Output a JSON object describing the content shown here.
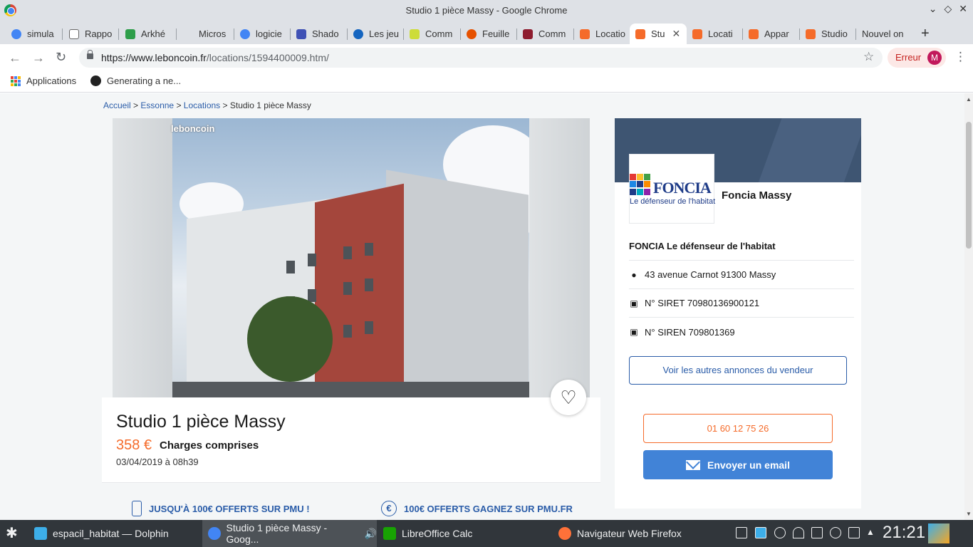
{
  "window": {
    "title": "Studio 1 pièce Massy - Google Chrome"
  },
  "tabs": [
    {
      "label": "simula",
      "color": "#4285f4"
    },
    {
      "label": "Rappo",
      "color": "#cccccc"
    },
    {
      "label": "Arkhé",
      "color": "#2e9e4a"
    },
    {
      "label": "Micros",
      "color": "#dee1e6"
    },
    {
      "label": "logicie",
      "color": "#4285f4"
    },
    {
      "label": "Shado",
      "color": "#3f51b5"
    },
    {
      "label": "Les jeu",
      "color": "#1565c0"
    },
    {
      "label": "Comm",
      "color": "#cddc39"
    },
    {
      "label": "Feuille",
      "color": "#e65100"
    },
    {
      "label": "Comm",
      "color": "#8e1c2f"
    },
    {
      "label": "Locatio",
      "color": "#f56b2a"
    },
    {
      "label": "Stu",
      "color": "#f56b2a",
      "active": true
    },
    {
      "label": "Locati",
      "color": "#f56b2a"
    },
    {
      "label": "Appar",
      "color": "#f56b2a"
    },
    {
      "label": "Studio",
      "color": "#f56b2a"
    },
    {
      "label": "Nouvel on",
      "color": "#dee1e6"
    }
  ],
  "address_bar": {
    "host": "https://www.leboncoin.fr",
    "path": "/locations/1594400009.htm/",
    "error_label": "Erreur",
    "profile_initial": "M"
  },
  "bookmarks": {
    "apps_label": "Applications",
    "item_label": "Generating a ne..."
  },
  "breadcrumb": {
    "home": "Accueil",
    "region": "Essonne",
    "category": "Locations",
    "current": "Studio 1 pièce Massy",
    "sep": ">"
  },
  "listing": {
    "watermark": "leboncoin",
    "title": "Studio 1 pièce Massy",
    "price": "358 €",
    "charges": "Charges comprises",
    "date": "03/04/2019 à 08h39"
  },
  "promos": [
    {
      "label": "JUSQU'À 100€ OFFERTS SUR PMU !"
    },
    {
      "label": "100€ OFFERTS GAGNEZ SUR PMU.FR",
      "glyph": "€"
    }
  ],
  "seller": {
    "logo_text": "FONCIA",
    "logo_tagline": "Le défenseur de l'habitat",
    "name": "Foncia Massy",
    "company": "FONCIA Le défenseur de l'habitat",
    "address": "43 avenue Carnot 91300 Massy",
    "siret": "N° SIRET 70980136900121",
    "siren": "N° SIREN 709801369",
    "other_ads_label": "Voir les autres annonces du vendeur",
    "phone": "01 60 12 75 26",
    "email_label": "Envoyer un email"
  },
  "taskbar": {
    "items": [
      {
        "label": "espacil_habitat — Dolphin",
        "color": "#3daee9"
      },
      {
        "label": "Studio 1 pièce Massy - Goog...",
        "color": "#4285f4",
        "active": true
      },
      {
        "label": "LibreOffice Calc",
        "color": "#18a303"
      },
      {
        "label": "Navigateur Web Firefox",
        "color": "#ff7139"
      }
    ],
    "clock": "21:21"
  },
  "colors": {
    "accent_orange": "#f56b2a",
    "link_blue": "#2a5ca8",
    "button_blue": "#4183d7",
    "seller_banner": "#3e5572"
  }
}
